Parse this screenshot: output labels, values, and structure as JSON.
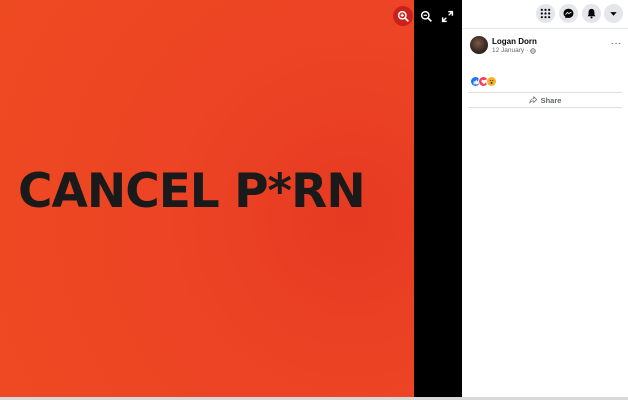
{
  "photo": {
    "text": "CANCEL P*RN",
    "background_color": "#ec4324"
  },
  "viewer_controls": {
    "zoom_in_icon": "zoom-in-icon",
    "zoom_out_icon": "zoom-out-icon",
    "fullscreen_icon": "fullscreen-icon"
  },
  "topbar": {
    "icons": [
      "menu-grid-icon",
      "messenger-icon",
      "notifications-icon",
      "account-chevron-icon"
    ]
  },
  "post": {
    "author": "Logan Dorn",
    "date": "12 January",
    "separator": "·",
    "more": "···",
    "reactions": [
      "like",
      "love",
      "wow"
    ],
    "share_label": "Share"
  },
  "colors": {
    "accent": "#1877f2",
    "zoom_active": "#c9221c"
  }
}
